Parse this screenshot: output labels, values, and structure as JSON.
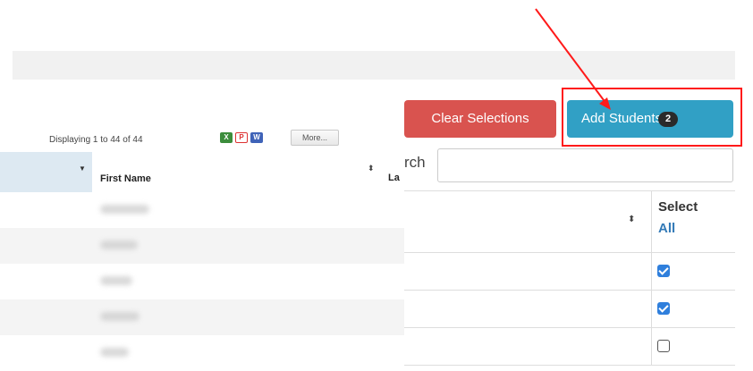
{
  "back_panel": {
    "displaying": "Displaying 1 to 44 of 44",
    "export_icons": [
      "excel-icon",
      "pdf-icon",
      "word-icon"
    ],
    "more_label": "More...",
    "columns": {
      "first_name": "First Name",
      "last_name_partial": "La"
    },
    "rows": [
      {
        "blur_width": 0.18
      },
      {
        "blur_width": 0.12
      },
      {
        "blur_width": 0.1
      },
      {
        "blur_width": 0.13
      },
      {
        "blur_width": 0.09
      }
    ]
  },
  "actions": {
    "clear_label": "Clear Selections",
    "add_label": "Add Students",
    "add_count": "2"
  },
  "search": {
    "label": "rch",
    "placeholder": ""
  },
  "select_table": {
    "select_label": "Select",
    "select_all": "All",
    "rows": [
      {
        "checked": true
      },
      {
        "checked": true
      },
      {
        "checked": false
      }
    ]
  },
  "colors": {
    "clear": "#d9534f",
    "add": "#31a0c5",
    "highlight": "#ff1a1a",
    "checkbox": "#2f7fdc"
  }
}
